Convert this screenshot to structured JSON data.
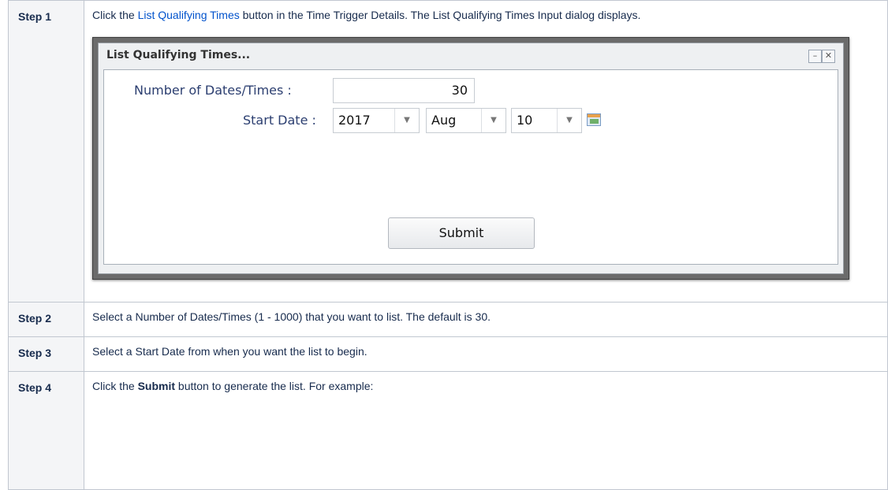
{
  "steps": [
    {
      "label": "Step 1",
      "text_before": "Click the ",
      "link_text": "List Qualifying Times",
      "text_after": " button in the Time Trigger Details. The List Qualifying Times Input dialog displays."
    },
    {
      "label": "Step 2",
      "text": "Select a Number of Dates/Times (1 - 1000) that you want to list. The default is 30."
    },
    {
      "label": "Step 3",
      "text": "Select a Start Date from when you want the list to begin."
    },
    {
      "label": "Step 4",
      "text_before": "Click the ",
      "bold": "Submit",
      "text_after": " button to generate the list. For example:"
    }
  ],
  "dialog": {
    "title": "List Qualifying Times...",
    "minimize_icon": "minimize-icon",
    "close_icon": "close-icon",
    "number_label": "Number of Dates/Times :",
    "number_value": "30",
    "start_date_label": "Start Date :",
    "year": "2017",
    "month": "Aug",
    "day": "10",
    "calendar_icon": "calendar-icon",
    "submit_label": "Submit"
  },
  "colors": {
    "link": "#0052cc",
    "header_bg": "#f4f5f7",
    "border": "#c1c7d0"
  }
}
